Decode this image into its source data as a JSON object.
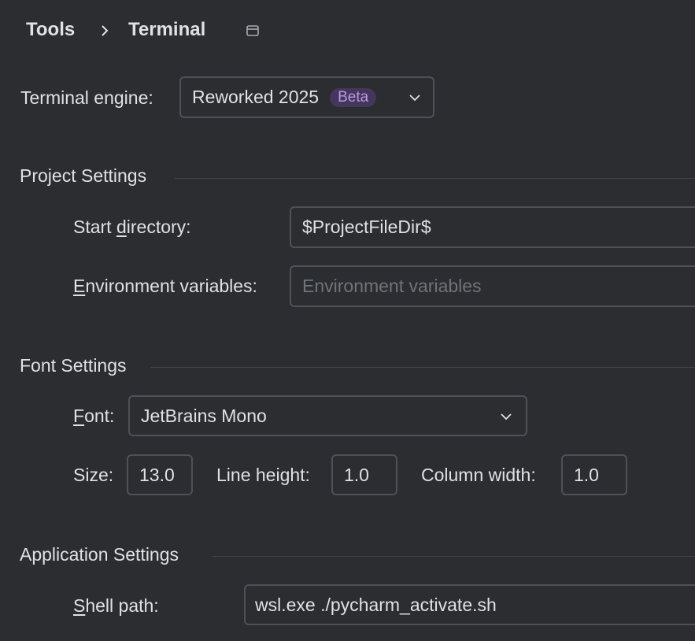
{
  "breadcrumb": {
    "parent": "Tools",
    "current": "Terminal"
  },
  "terminal_engine": {
    "label": "Terminal engine:",
    "value": "Reworked 2025",
    "badge": "Beta"
  },
  "project_settings": {
    "title": "Project Settings",
    "start_directory": {
      "label_prefix": "Start ",
      "label_mnemonic": "d",
      "label_suffix": "irectory:",
      "value": "$ProjectFileDir$"
    },
    "environment_variables": {
      "label_mnemonic": "E",
      "label_suffix": "nvironment variables:",
      "value": "",
      "placeholder": "Environment variables"
    }
  },
  "font_settings": {
    "title": "Font Settings",
    "font": {
      "label_mnemonic": "F",
      "label_suffix": "ont:",
      "value": "JetBrains Mono"
    },
    "size": {
      "label": "Size:",
      "value": "13.0"
    },
    "line_height": {
      "label": "Line height:",
      "value": "1.0"
    },
    "column_width": {
      "label": "Column width:",
      "value": "1.0"
    }
  },
  "application_settings": {
    "title": "Application Settings",
    "shell_path": {
      "label_mnemonic": "S",
      "label_suffix": "hell path:",
      "value": "wsl.exe ./pycharm_activate.sh"
    }
  },
  "colors": {
    "background": "#2b2d30",
    "border": "#4e5157",
    "text": "#dfe1e5",
    "badge_bg": "#45365e",
    "badge_text": "#b89ae0"
  }
}
